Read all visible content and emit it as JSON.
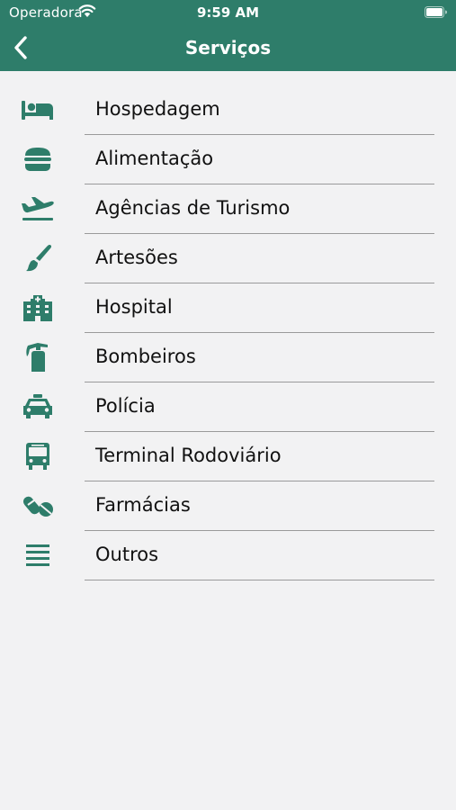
{
  "status_bar": {
    "carrier": "Operadora",
    "time": "9:59 AM"
  },
  "header": {
    "title": "Serviços"
  },
  "colors": {
    "accent": "#2e7d6a",
    "background": "#f2f2f3",
    "divider": "#9a9a9a"
  },
  "services": [
    {
      "label": "Hospedagem",
      "icon": "bed-icon"
    },
    {
      "label": "Alimentação",
      "icon": "burger-icon"
    },
    {
      "label": "Agências de Turismo",
      "icon": "airplane-icon"
    },
    {
      "label": "Artesões",
      "icon": "paintbrush-icon"
    },
    {
      "label": "Hospital",
      "icon": "hospital-icon"
    },
    {
      "label": "Bombeiros",
      "icon": "fire-extinguisher-icon"
    },
    {
      "label": "Polícia",
      "icon": "car-icon"
    },
    {
      "label": "Terminal Rodoviário",
      "icon": "bus-icon"
    },
    {
      "label": "Farmácias",
      "icon": "pills-icon"
    },
    {
      "label": "Outros",
      "icon": "list-icon"
    }
  ]
}
